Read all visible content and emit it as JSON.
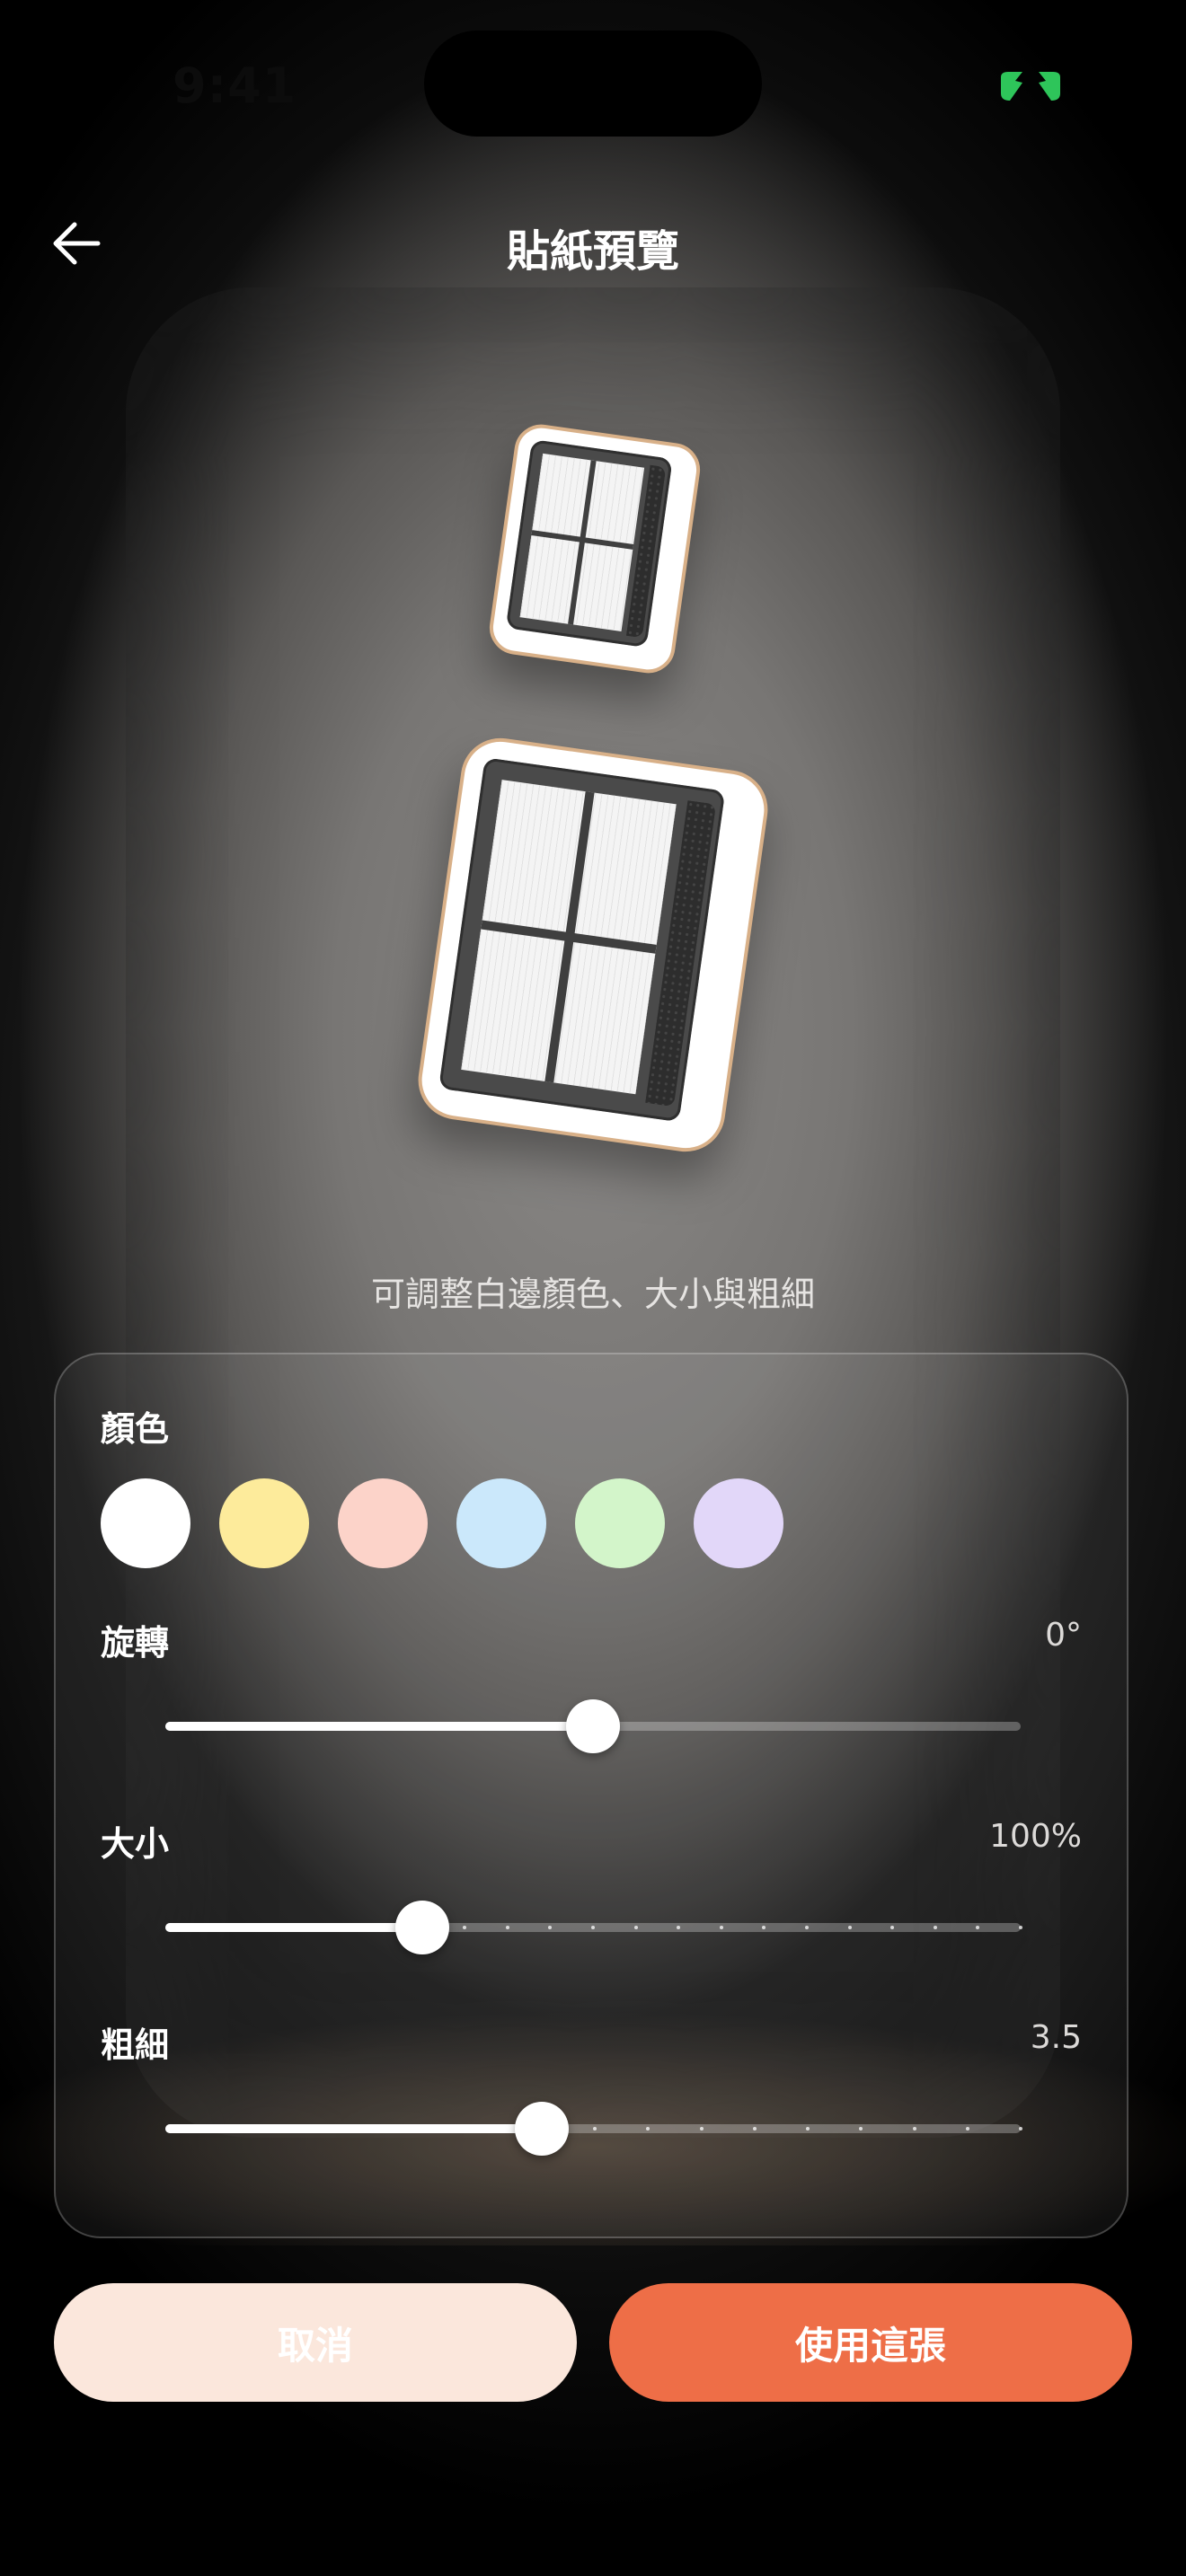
{
  "status_bar": {
    "time": "9:41"
  },
  "header": {
    "title": "貼紙預覽"
  },
  "hint": "可調整白邊顏色、大小與粗細",
  "panel": {
    "color": {
      "label": "顏色",
      "swatches": [
        "#ffffff",
        "#fdeb9b",
        "#fcd3c9",
        "#cbe8fb",
        "#d3f5ca",
        "#e2d7f9"
      ],
      "selected_index": 0
    },
    "rotation": {
      "label": "旋轉",
      "value_text": "0°",
      "fraction": 0.5
    },
    "size": {
      "label": "大小",
      "value_text": "100%",
      "fraction": 0.3,
      "ticks": 14
    },
    "thickness": {
      "label": "粗細",
      "value_text": "3.5",
      "fraction": 0.44,
      "ticks": 9
    }
  },
  "buttons": {
    "cancel": "取消",
    "use": "使用這張"
  },
  "colors": {
    "accent": "#ee6e47",
    "cancel_bg": "#fbe7dc",
    "border_warm": "#d8b088",
    "battery_green": "#2ec55a"
  }
}
